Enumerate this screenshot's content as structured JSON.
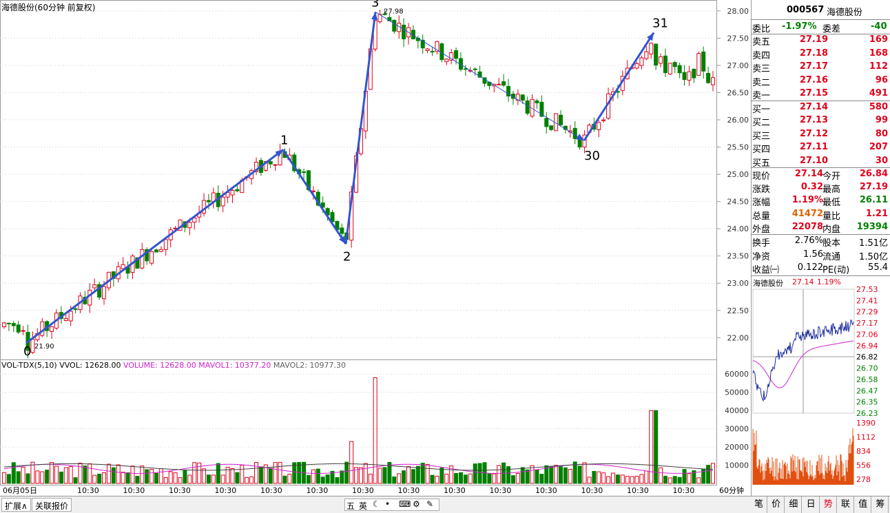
{
  "chart_title": "海德股份(60分钟 前复权)",
  "vol_title": {
    "prefix": "VOL-TDX(5,10)",
    "vvol": "VVOL: 12628.00",
    "volume": "VOLUME: 12628.00",
    "mavol1": "MAVOL1: 10377.20",
    "mavol2": "MAVOL2: 10977.30"
  },
  "colors": {
    "up": "#e0001a",
    "down": "#008000",
    "wave": "#3055d0",
    "mavol1": "#d020d0",
    "mavol2": "#404040"
  },
  "chart_data": {
    "type": "candlestick",
    "price_axis": [
      "28.00",
      "27.50",
      "27.00",
      "26.50",
      "26.00",
      "25.50",
      "25.00",
      "24.50",
      "24.00",
      "23.50",
      "23.00",
      "22.50",
      "22.00"
    ],
    "price_range": [
      21.65,
      28.15
    ],
    "volume_axis": [
      "60000",
      "50000",
      "40000",
      "30000",
      "20000",
      "10000"
    ],
    "volume_range": [
      0,
      65000
    ],
    "time_labels": [
      "06月05日",
      "10:30",
      "10:30",
      "10:30",
      "10:30",
      "10:30",
      "10:30",
      "10:30",
      "10:30",
      "10:30",
      "10:30",
      "10:30",
      "10:30",
      "10:30",
      "10:30"
    ],
    "period_label": "60分钟",
    "wave_points": [
      {
        "label": "0",
        "price": 21.9
      },
      {
        "label": "1",
        "price": 25.45
      },
      {
        "label": "2",
        "price": 23.72
      },
      {
        "label": "3",
        "price": 27.98
      },
      {
        "label": "30",
        "price": 25.62
      },
      {
        "label": "31",
        "price": 27.6
      }
    ],
    "annotations": [
      "21.90",
      "27.98"
    ]
  },
  "quote": {
    "code": "000567",
    "name": "海德股份",
    "weibi_label": "委比",
    "weibi": "-1.97%",
    "weicha_label": "委差",
    "weicha": "-40",
    "asks": [
      {
        "label": "卖五",
        "price": "27.19",
        "vol": "169"
      },
      {
        "label": "卖四",
        "price": "27.18",
        "vol": "168"
      },
      {
        "label": "卖三",
        "price": "27.17",
        "vol": "112"
      },
      {
        "label": "卖二",
        "price": "27.16",
        "vol": "96"
      },
      {
        "label": "卖一",
        "price": "27.15",
        "vol": "491"
      }
    ],
    "bids": [
      {
        "label": "买一",
        "price": "27.14",
        "vol": "580"
      },
      {
        "label": "买二",
        "price": "27.13",
        "vol": "99"
      },
      {
        "label": "买三",
        "price": "27.12",
        "vol": "80"
      },
      {
        "label": "买四",
        "price": "27.11",
        "vol": "207"
      },
      {
        "label": "买五",
        "price": "27.10",
        "vol": "30"
      }
    ],
    "stats": [
      {
        "l1": "现价",
        "v1": "27.14",
        "c1": "red",
        "l2": "今开",
        "v2": "26.84",
        "c2": "red"
      },
      {
        "l1": "涨跌",
        "v1": "0.32",
        "c1": "red",
        "l2": "最高",
        "v2": "27.19",
        "c2": "red"
      },
      {
        "l1": "涨幅",
        "v1": "1.19%",
        "c1": "red",
        "l2": "最低",
        "v2": "26.11",
        "c2": "green"
      },
      {
        "l1": "总量",
        "v1": "41472",
        "c1": "orange",
        "l2": "量比",
        "v2": "1.21",
        "c2": "red"
      },
      {
        "l1": "外盘",
        "v1": "22078",
        "c1": "red",
        "l2": "内盘",
        "v2": "19394",
        "c2": "green"
      }
    ],
    "fund": [
      {
        "l1": "换手",
        "v1": "2.76%",
        "l2": "股本",
        "v2": "1.51亿"
      },
      {
        "l1": "净资",
        "v1": "1.56",
        "l2": "流通",
        "v2": "1.50亿"
      },
      {
        "l1": "收益㈠",
        "v1": "0.122",
        "l2": "PE(动)",
        "v2": "55.4"
      }
    ]
  },
  "mini": {
    "name": "海德股份",
    "price": "27.14",
    "pct": "1.19%",
    "price_axis": [
      "27.53",
      "27.41",
      "27.29",
      "27.17",
      "27.06",
      "26.94",
      "26.82",
      "26.70",
      "26.58",
      "26.47",
      "26.35",
      "26.23"
    ],
    "vol_axis": [
      "1390",
      "1112",
      "834",
      "556",
      "278"
    ]
  },
  "bottom": {
    "tabs": [
      "扩展∧",
      "关联报价"
    ],
    "ime": [
      "五",
      "英"
    ],
    "right_tabs": [
      "笔",
      "价",
      "细",
      "日",
      "势",
      "联",
      "值",
      "筹"
    ]
  }
}
